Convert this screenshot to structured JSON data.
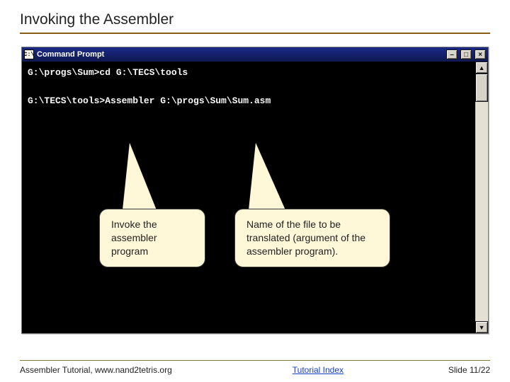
{
  "slide": {
    "title": "Invoking the Assembler"
  },
  "cmd": {
    "window_title": "Command Prompt",
    "icon_text": "C:\\",
    "line1": "G:\\progs\\Sum>cd G:\\TECS\\tools",
    "line2": "G:\\TECS\\tools>Assembler G:\\progs\\Sum\\Sum.asm"
  },
  "callouts": {
    "c1": "Invoke the assembler program",
    "c2": "Name of the file to be translated (argument of the assembler program)."
  },
  "footer": {
    "left": "Assembler Tutorial, www.nand2tetris.org",
    "center": "Tutorial Index",
    "right": "Slide 11/22"
  },
  "glyphs": {
    "minimize": "–",
    "maximize": "□",
    "close": "×",
    "up": "▲",
    "down": "▼"
  }
}
